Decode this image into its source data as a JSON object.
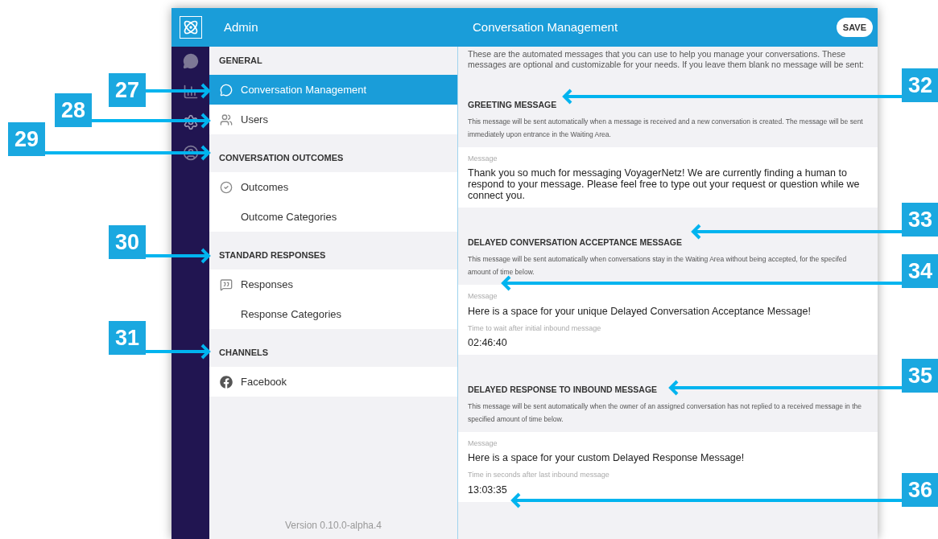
{
  "header": {
    "section": "Admin",
    "title": "Conversation Management",
    "save_button": "SAVE"
  },
  "sidebar": {
    "sections": [
      {
        "header": "GENERAL",
        "items": [
          {
            "label": "Conversation Management",
            "kind": "chat",
            "selected": true
          },
          {
            "label": "Users",
            "kind": "users",
            "selected": false
          }
        ]
      },
      {
        "header": "CONVERSATION OUTCOMES",
        "items": [
          {
            "label": "Outcomes",
            "kind": "check",
            "selected": false
          },
          {
            "label": "Outcome Categories",
            "kind": "plain",
            "selected": false
          }
        ]
      },
      {
        "header": "STANDARD RESPONSES",
        "items": [
          {
            "label": "Responses",
            "kind": "quote",
            "selected": false
          },
          {
            "label": "Response Categories",
            "kind": "plain",
            "selected": false
          }
        ]
      },
      {
        "header": "CHANNELS",
        "items": [
          {
            "label": "Facebook",
            "kind": "facebook",
            "selected": false
          }
        ]
      }
    ],
    "version": "Version 0.10.0-alpha.4"
  },
  "main": {
    "intro": "These are the automated messages that you can use to help you manage your conversations. These messages are optional and customizable for your needs. If you leave them blank no message will be sent:",
    "sections": [
      {
        "heading": "GREETING MESSAGE",
        "description": "This message will be sent automatically when a message is received and a new conversation is created. The message will be sent immediately upon entrance in the Waiting Area.",
        "fields": [
          {
            "label": "Message",
            "value": "Thank you so much for messaging VoyagerNetz! We are currently finding a human to respond to your message. Please feel free to type out your request or question while we connect you."
          }
        ]
      },
      {
        "heading": "DELAYED CONVERSATION ACCEPTANCE MESSAGE",
        "description": "This message will be sent automatically when conversations stay in the Waiting Area without being accepted, for the specifed amount of time below.",
        "fields": [
          {
            "label": "Message",
            "value": "Here is a space for your unique Delayed Conversation Acceptance Message!"
          },
          {
            "label": "Time to wait after initial inbound message",
            "value": "02:46:40"
          }
        ]
      },
      {
        "heading": "DELAYED RESPONSE TO INBOUND MESSAGE",
        "description": "This message will be sent automatically when the owner of an assigned conversation has not replied to a received message in the specified amount of time below.",
        "fields": [
          {
            "label": "Message",
            "value": "Here is a space for your custom Delayed Response Message!"
          },
          {
            "label": "Time in seconds after last inbound message",
            "value": "13:03:35"
          }
        ]
      }
    ]
  },
  "callouts": [
    {
      "number": "27"
    },
    {
      "number": "28"
    },
    {
      "number": "29"
    },
    {
      "number": "30"
    },
    {
      "number": "31"
    },
    {
      "number": "32"
    },
    {
      "number": "33"
    },
    {
      "number": "34"
    },
    {
      "number": "35"
    },
    {
      "number": "36"
    }
  ]
}
